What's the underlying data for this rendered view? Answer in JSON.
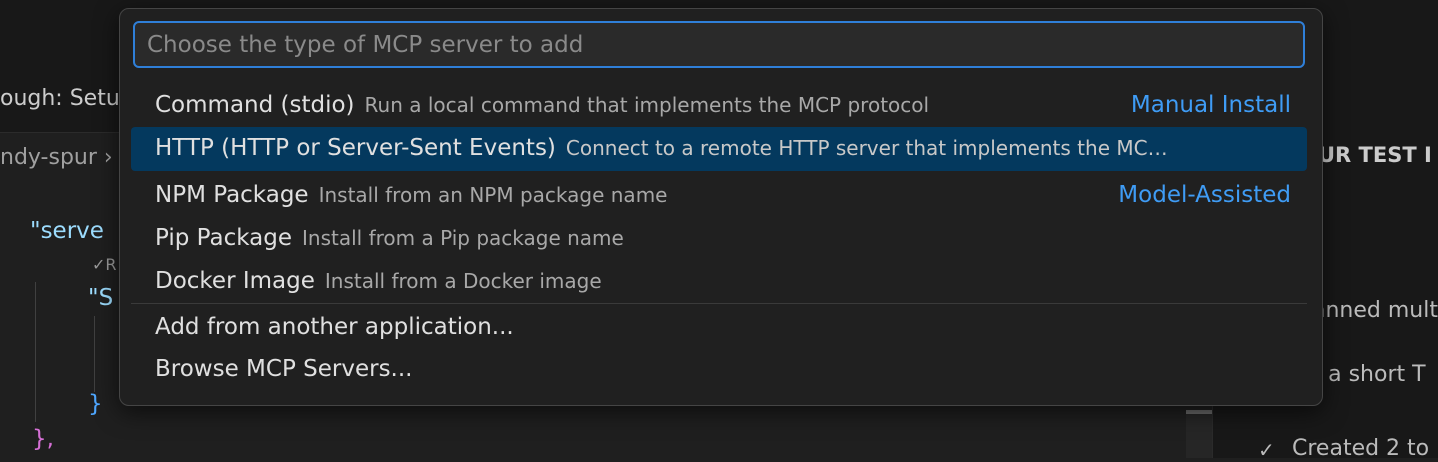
{
  "background": {
    "tab_label": "ough: Setu",
    "breadcrumb": "ndy-spur",
    "breadcrumb_chevron": "›",
    "code": {
      "line1": "\"serve",
      "codelens": "✓R",
      "line2": "\"S",
      "line3": "}",
      "line4": "},"
    },
    "right_panel": {
      "title": "UR TEST I",
      "text1": "anned mult",
      "text2": "l a short T",
      "text3": "Created 2 to",
      "check_icon": "✓"
    }
  },
  "quick_pick": {
    "placeholder": "Choose the type of MCP server to add",
    "items": [
      {
        "label": "Command (stdio)",
        "description": "Run a local command that implements the MCP protocol",
        "tag": "Manual Install",
        "selected": false
      },
      {
        "label": "HTTP (HTTP or Server-Sent Events)",
        "description": "Connect to a remote HTTP server that implements the MC…",
        "tag": "",
        "selected": true
      },
      {
        "label": "NPM Package",
        "description": "Install from an NPM package name",
        "tag": "Model-Assisted",
        "selected": false
      },
      {
        "label": "Pip Package",
        "description": "Install from a Pip package name",
        "tag": "",
        "selected": false
      },
      {
        "label": "Docker Image",
        "description": "Install from a Docker image",
        "tag": "",
        "selected": false
      },
      {
        "label": "Add from another application...",
        "description": "",
        "tag": "",
        "selected": false
      },
      {
        "label": "Browse MCP Servers...",
        "description": "",
        "tag": "",
        "selected": false
      }
    ]
  },
  "colors": {
    "accent": "#2f7fd8",
    "selection": "#04395e",
    "tag_link": "#3f9cf5"
  }
}
